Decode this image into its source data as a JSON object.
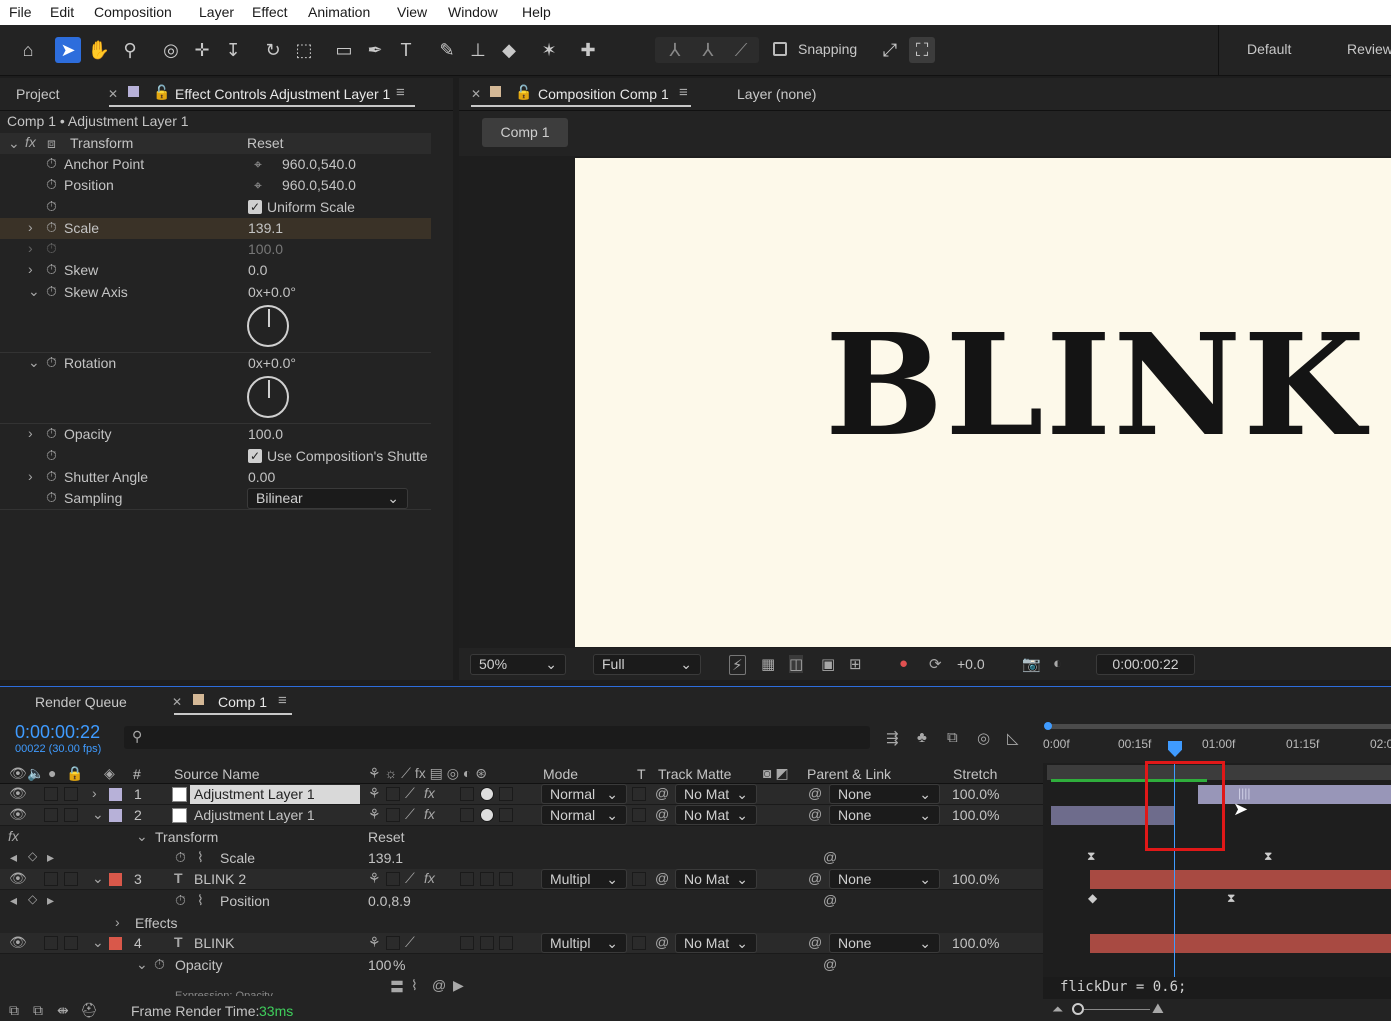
{
  "menu": [
    "File",
    "Edit",
    "Composition",
    "Layer",
    "Effect",
    "Animation",
    "View",
    "Window",
    "Help"
  ],
  "toolbar": {
    "snapping": "Snapping",
    "workspace_default": "Default",
    "workspace_review": "Review"
  },
  "left_panel": {
    "tab_project": "Project",
    "tab_effect_controls": "Effect Controls Adjustment Layer 1",
    "breadcrumb": "Comp 1 • Adjustment Layer 1",
    "fx": "fx",
    "transform_label": "Transform",
    "reset": "Reset",
    "props": {
      "anchor_point": {
        "label": "Anchor Point",
        "value": "960.0,540.0"
      },
      "position": {
        "label": "Position",
        "value": "960.0,540.0"
      },
      "uniform_scale": "Uniform Scale",
      "scale": {
        "label": "Scale",
        "value": "139.1"
      },
      "scale_width": "100.0",
      "skew": {
        "label": "Skew",
        "value": "0.0"
      },
      "skew_axis": {
        "label": "Skew Axis",
        "value": "0x+0.0°"
      },
      "rotation": {
        "label": "Rotation",
        "value": "0x+0.0°"
      },
      "opacity": {
        "label": "Opacity",
        "value": "100.0"
      },
      "use_comp_shutter": "Use Composition's Shutte",
      "shutter_angle": {
        "label": "Shutter Angle",
        "value": "0.00"
      },
      "sampling": {
        "label": "Sampling",
        "value": "Bilinear"
      }
    }
  },
  "comp_panel": {
    "tab": "Composition Comp 1",
    "layer_tab": "Layer (none)",
    "comp_button": "Comp 1",
    "canvas_text": "BLINK",
    "canvas_bg": "#fdf9ea",
    "zoom": "50%",
    "resolution": "Full",
    "exposure": "+0.0",
    "timecode": "0:00:00:22"
  },
  "timeline": {
    "tab_render_queue": "Render Queue",
    "tab_comp": "Comp 1",
    "current_time": "0:00:00:22",
    "frame_info": "00022 (30.00 fps)",
    "search_placeholder": "",
    "headers": {
      "num": "#",
      "source_name": "Source Name",
      "mode": "Mode",
      "t": "T",
      "track_matte": "Track Matte",
      "parent": "Parent & Link",
      "stretch": "Stretch"
    },
    "ruler": [
      "0:00f",
      "00:15f",
      "01:00f",
      "01:15f",
      "02:0"
    ],
    "layers": [
      {
        "num": "1",
        "name": "Adjustment Layer 1",
        "mode": "Normal",
        "matte": "No Mat",
        "parent": "None",
        "stretch": "100.0%",
        "label_color": "#b7b1d8"
      },
      {
        "num": "2",
        "name": "Adjustment Layer 1",
        "mode": "Normal",
        "matte": "No Mat",
        "parent": "None",
        "stretch": "100.0%",
        "label_color": "#b7b1d8"
      },
      {
        "num": "3",
        "name": "BLINK 2",
        "mode": "Multipl",
        "matte": "No Mat",
        "parent": "None",
        "stretch": "100.0%",
        "label_color": "#d9584a"
      },
      {
        "num": "4",
        "name": "BLINK",
        "mode": "Multipl",
        "matte": "No Mat",
        "parent": "None",
        "stretch": "100.0%",
        "label_color": "#d9584a"
      }
    ],
    "sub": {
      "transform": "Transform",
      "reset": "Reset",
      "scale_label": "Scale",
      "scale_value": "139.1",
      "position_label": "Position",
      "position_value": "0.0,8.9",
      "effects": "Effects",
      "opacity_label": "Opacity",
      "opacity_value": "100",
      "opacity_unit": "%",
      "expression_label": "Expression: Opacity"
    },
    "expression_text": "flickDur = 0.6;",
    "frame_render_label": "Frame Render Time:",
    "frame_render_value": "33ms"
  }
}
